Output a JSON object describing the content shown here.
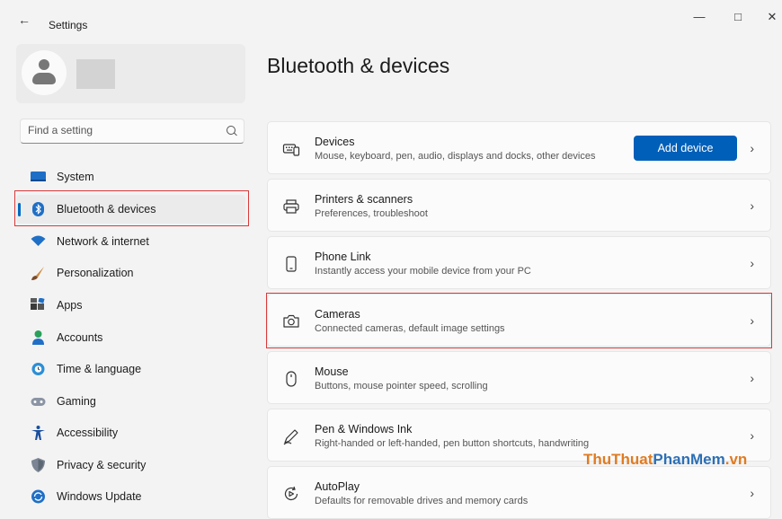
{
  "window": {
    "title": "Settings",
    "controls": [
      "minimize",
      "maximize",
      "close"
    ]
  },
  "search": {
    "placeholder": "Find a setting"
  },
  "sidebar": {
    "items": [
      {
        "label": "System",
        "icon": "monitor-icon"
      },
      {
        "label": "Bluetooth & devices",
        "icon": "bluetooth-icon",
        "active": true
      },
      {
        "label": "Network & internet",
        "icon": "wifi-icon"
      },
      {
        "label": "Personalization",
        "icon": "brush-icon"
      },
      {
        "label": "Apps",
        "icon": "apps-icon"
      },
      {
        "label": "Accounts",
        "icon": "person-icon"
      },
      {
        "label": "Time & language",
        "icon": "globe-clock-icon"
      },
      {
        "label": "Gaming",
        "icon": "gamepad-icon"
      },
      {
        "label": "Accessibility",
        "icon": "accessibility-icon"
      },
      {
        "label": "Privacy & security",
        "icon": "shield-icon"
      },
      {
        "label": "Windows Update",
        "icon": "update-icon"
      }
    ]
  },
  "main": {
    "title": "Bluetooth & devices",
    "cards": [
      {
        "title": "Devices",
        "description": "Mouse, keyboard, pen, audio, displays and docks, other devices",
        "icon": "keyboard-icon",
        "button": "Add device"
      },
      {
        "title": "Printers & scanners",
        "description": "Preferences, troubleshoot",
        "icon": "printer-icon"
      },
      {
        "title": "Phone Link",
        "description": "Instantly access your mobile device from your PC",
        "icon": "phone-icon"
      },
      {
        "title": "Cameras",
        "description": "Connected cameras, default image settings",
        "icon": "camera-icon",
        "highlighted": true
      },
      {
        "title": "Mouse",
        "description": "Buttons, mouse pointer speed, scrolling",
        "icon": "mouse-icon"
      },
      {
        "title": "Pen & Windows Ink",
        "description": "Right-handed or left-handed, pen button shortcuts, handwriting",
        "icon": "pen-icon"
      },
      {
        "title": "AutoPlay",
        "description": "Defaults for removable drives and memory cards",
        "icon": "autoplay-icon"
      }
    ]
  },
  "watermark": {
    "part1": "ThuThuat",
    "part2": "PhanMem",
    "part3": ".vn"
  },
  "colors": {
    "accent": "#0067c0",
    "button": "#005fb8",
    "highlight_border": "#d93a3a"
  }
}
